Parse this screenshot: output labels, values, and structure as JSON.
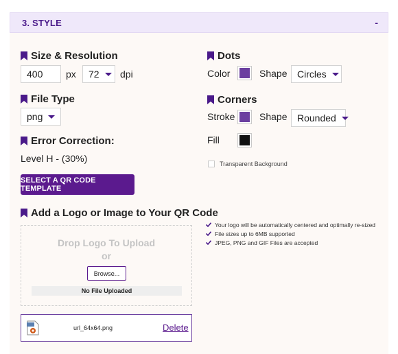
{
  "section": {
    "title": "3. STYLE",
    "collapse_symbol": "-"
  },
  "size": {
    "heading": "Size & Resolution",
    "width_value": "400",
    "unit": "px",
    "dpi_value": "72",
    "dpi_label": "dpi"
  },
  "file_type": {
    "heading": "File Type",
    "value": "png"
  },
  "error_correction": {
    "heading": "Error Correction:",
    "value": "Level H - (30%)"
  },
  "template_button": "SELECT A QR CODE TEMPLATE",
  "dots": {
    "heading": "Dots",
    "color_label": "Color",
    "color": "#6b3fa0",
    "shape_label": "Shape",
    "shape_value": "Circles"
  },
  "corners": {
    "heading": "Corners",
    "stroke_label": "Stroke",
    "stroke_color": "#6b3fa0",
    "shape_label": "Shape",
    "shape_value": "Rounded",
    "fill_label": "Fill",
    "fill_color": "#111111"
  },
  "transparent_label": "Transparent Background",
  "logo": {
    "heading": "Add a Logo or Image to Your QR Code",
    "drop_text_1": "Drop Logo To Upload",
    "drop_text_2": "or",
    "browse_label": "Browse...",
    "no_file": "No File Uploaded",
    "filename": "url_64x64.png",
    "delete_label": "Delete",
    "thumb_badge": "PNG"
  },
  "info": [
    "Your logo will be automatically centered and optimally re-sized",
    "File sizes up to 6MB supported",
    "JPEG, PNG and GIF Files are accepted"
  ],
  "colors": {
    "accent": "#5b1a8e",
    "header_bg": "#efe8fa",
    "panel_bg": "#fdf9f6"
  }
}
